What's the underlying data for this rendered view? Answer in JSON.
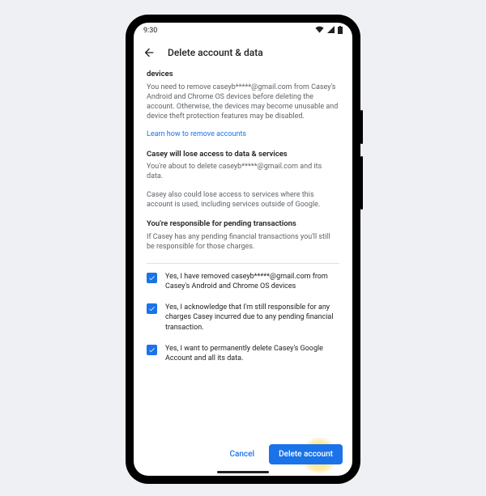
{
  "status": {
    "time": "9:30"
  },
  "appbar": {
    "title": "Delete account & data"
  },
  "sections": {
    "devices": {
      "heading": "devices",
      "body": "You need to remove caseyb*****@gmail.com from Casey's Android and Chrome OS devices before deleting the account. Otherwise, the devices may become unusable and device theft protection features may be disabled.",
      "link": "Learn how to remove accounts"
    },
    "lose_access": {
      "heading": "Casey will lose access to data & services",
      "body1": "You're about to delete caseyb*****@gmail.com and its data.",
      "body2": "Casey also could lose access to services where this account is used, including services outside of Google."
    },
    "pending": {
      "heading": "You're responsible for pending transactions",
      "body": "If Casey has any pending financial transactions you'll still be responsible for those charges."
    }
  },
  "checks": [
    {
      "label": "Yes, I have removed caseyb*****@gmail.com from Casey's Android and Chrome OS devices"
    },
    {
      "label": "Yes, I acknowledge that I'm still responsible for any charges Casey incurred due to any pending financial transaction."
    },
    {
      "label": "Yes, I want to permanently delete Casey's Google Account and all its data."
    }
  ],
  "buttons": {
    "cancel": "Cancel",
    "delete": "Delete account"
  }
}
